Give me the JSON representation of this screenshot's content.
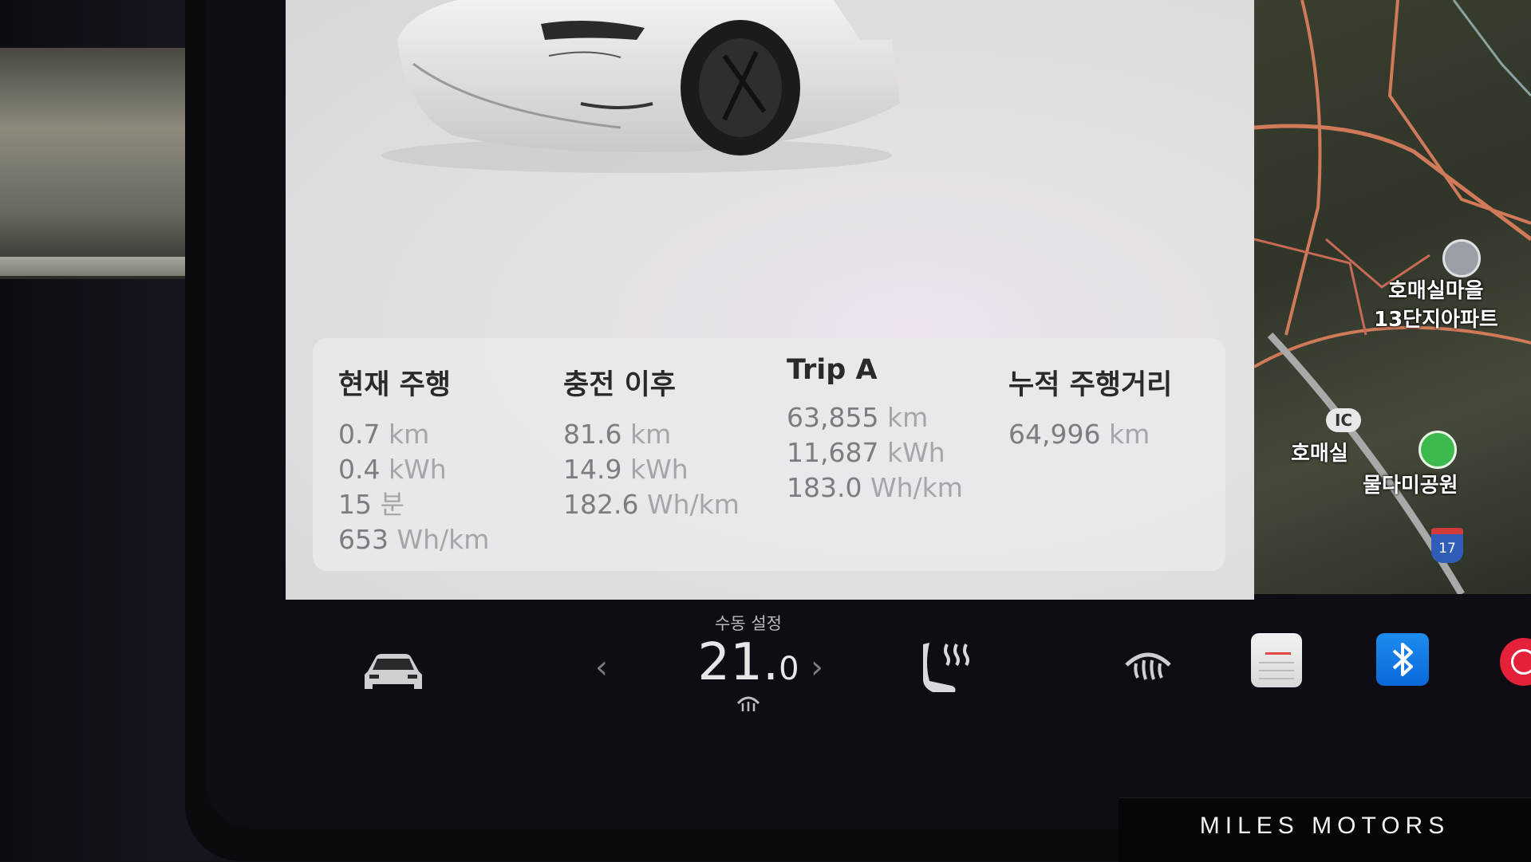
{
  "trip_panel": {
    "columns": [
      {
        "title": "현재 주행",
        "stats": [
          {
            "value": "0.7",
            "unit": "km"
          },
          {
            "value": "0.4",
            "unit": "kWh"
          },
          {
            "value": "15",
            "unit": "분"
          },
          {
            "value": "653",
            "unit": "Wh/km"
          }
        ]
      },
      {
        "title": "충전 이후",
        "stats": [
          {
            "value": "81.6",
            "unit": "km"
          },
          {
            "value": "14.9",
            "unit": "kWh"
          },
          {
            "value": "182.6",
            "unit": "Wh/km"
          }
        ]
      },
      {
        "title": "Trip A",
        "stats": [
          {
            "value": "63,855",
            "unit": "km"
          },
          {
            "value": "11,687",
            "unit": "kWh"
          },
          {
            "value": "183.0",
            "unit": "Wh/km"
          }
        ]
      },
      {
        "title": "누적 주행거리",
        "stats": [
          {
            "value": "64,996",
            "unit": "km"
          }
        ]
      }
    ]
  },
  "map": {
    "labels": {
      "apartment_line1": "호매실마을",
      "apartment_line2": "13단지아파트",
      "interchange": "호매실",
      "park": "물다미공원"
    },
    "ic_badge": "IC",
    "route_number": "17"
  },
  "climate": {
    "mode_label": "수동 설정",
    "temp_integer": "21.",
    "temp_decimal": "0",
    "left_arrow": "‹",
    "right_arrow": "›"
  },
  "icons": {
    "car": "car-icon",
    "seat_heater": "seat-heater-icon",
    "rear_defrost": "rear-defrost-icon",
    "notes": "notes-app-icon",
    "bluetooth": "bluetooth-icon",
    "media": "media-player-icon"
  },
  "colors": {
    "bluetooth": "#0a69d8",
    "media": "#e5213a",
    "accent_red": "#e24b43"
  },
  "watermark": "MILES MOTORS"
}
